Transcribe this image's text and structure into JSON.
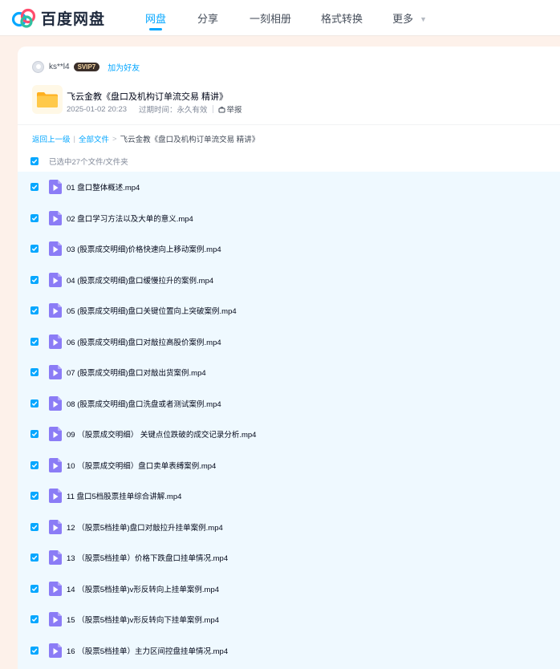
{
  "brand": {
    "name": "百度网盘"
  },
  "nav": [
    {
      "label": "网盘",
      "active": true
    },
    {
      "label": "分享",
      "active": false
    },
    {
      "label": "一刻相册",
      "active": false
    },
    {
      "label": "格式转换",
      "active": false
    },
    {
      "label": "更多",
      "active": false
    }
  ],
  "share": {
    "username": "ks**l4",
    "vip_badge": "SVIP7",
    "add_friend": "加为好友",
    "title": "飞云金教《盘口及机构订单流交易 精讲》",
    "date": "2025-01-02 20:23",
    "expire_label": "过期时间：",
    "expire_value": "永久有效",
    "report": "举报"
  },
  "breadcrumb": {
    "back": "返回上一级",
    "all": "全部文件",
    "current": "飞云金教《盘口及机构订单流交易 精讲》"
  },
  "selection_text": "已选中27个文件/文件夹",
  "files": [
    {
      "name": "01 盘口整体概述.mp4"
    },
    {
      "name": "02 盘口学习方法以及大单的意义.mp4"
    },
    {
      "name": "03 (股票成交明细)价格快速向上移动案例.mp4"
    },
    {
      "name": "04 (股票成交明细)盘口缓慢拉升的案例.mp4"
    },
    {
      "name": "05 (股票成交明细)盘口关键位置向上突破案例.mp4"
    },
    {
      "name": "06 (股票成交明细)盘口对敲拉高股价案例.mp4"
    },
    {
      "name": "07 (股票成交明细)盘口对敲出货案例.mp4"
    },
    {
      "name": "08 (股票成交明细)盘口洗盘或者测试案例.mp4"
    },
    {
      "name": "09 （股票成交明细） 关键点位跌破的成交记录分析.mp4"
    },
    {
      "name": "10 （股票成交明细）盘口卖单表缚案例.mp4"
    },
    {
      "name": "11 盘口5档股票挂单综合讲解.mp4"
    },
    {
      "name": "12 （股票5档挂单)盘口对敲拉升挂单案例.mp4"
    },
    {
      "name": "13 （股票5档挂单）价格下跌盘口挂单情况.mp4"
    },
    {
      "name": "14 （股票5档挂单)v形反转向上挂单案例.mp4"
    },
    {
      "name": "15 （股票5档挂单)v形反转向下挂单案例.mp4"
    },
    {
      "name": "16 （股票5档挂单）主力区间控盘挂单情况.mp4"
    }
  ],
  "colors": {
    "accent": "#06a7ff",
    "video_icon": "#8b7cf6",
    "folder": "#ffc233"
  }
}
